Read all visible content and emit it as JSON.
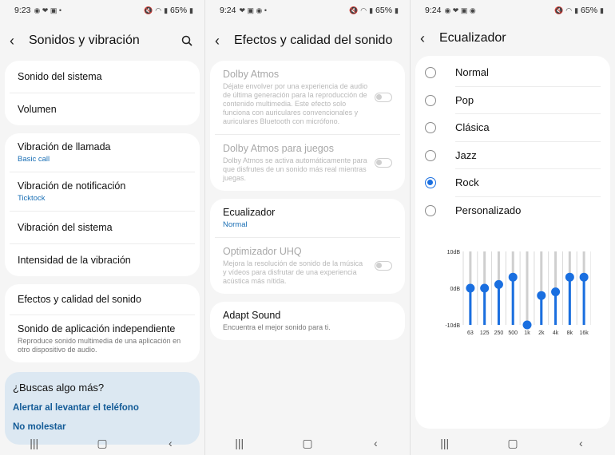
{
  "screen1": {
    "status": {
      "time": "9:23",
      "battery": "65%"
    },
    "title": "Sonidos y vibración",
    "group1": [
      {
        "title": "Sonido del sistema"
      },
      {
        "title": "Volumen"
      }
    ],
    "group2": [
      {
        "title": "Vibración de llamada",
        "sub": "Basic call"
      },
      {
        "title": "Vibración de notificación",
        "sub": "Ticktock"
      },
      {
        "title": "Vibración del sistema"
      },
      {
        "title": "Intensidad de la vibración"
      }
    ],
    "group3": [
      {
        "title": "Efectos y calidad del sonido"
      },
      {
        "title": "Sonido de aplicación independiente",
        "desc": "Reproduce sonido multimedia de una aplicación en otro dispositivo de audio."
      }
    ],
    "help": {
      "title": "¿Buscas algo más?",
      "link1": "Alertar al levantar el teléfono",
      "link2": "No molestar"
    }
  },
  "screen2": {
    "status": {
      "time": "9:24",
      "battery": "65%"
    },
    "title": "Efectos y calidad del sonido",
    "dolby": {
      "title": "Dolby Atmos",
      "desc": "Déjate envolver por una experiencia de audio de última generación para la reproducción de contenido multimedia. Este efecto solo funciona con auriculares convencionales y auriculares Bluetooth con micrófono."
    },
    "dolby_games": {
      "title": "Dolby Atmos para juegos",
      "desc": "Dolby Atmos se activa automáticamente para que disfrutes de un sonido más real mientras juegas."
    },
    "eq": {
      "title": "Ecualizador",
      "sub": "Normal"
    },
    "uhq": {
      "title": "Optimizador UHQ",
      "desc": "Mejora la resolución de sonido de la música y vídeos para disfrutar de una experiencia acústica más nítida."
    },
    "adapt": {
      "title": "Adapt Sound",
      "desc": "Encuentra el mejor sonido para ti."
    }
  },
  "screen3": {
    "status": {
      "time": "9:24",
      "battery": "65%"
    },
    "title": "Ecualizador",
    "options": [
      "Normal",
      "Pop",
      "Clásica",
      "Jazz",
      "Rock",
      "Personalizado"
    ],
    "selected": "Rock",
    "accent": "#1a6fe0"
  },
  "chart_data": {
    "type": "bar",
    "categories": [
      "63",
      "125",
      "250",
      "500",
      "1k",
      "2k",
      "4k",
      "8k",
      "16k"
    ],
    "values": [
      0,
      0,
      1,
      3,
      -10,
      -2,
      -1,
      3,
      3
    ],
    "ylim": [
      -10,
      10
    ],
    "yticks": [
      "10dB",
      "0dB",
      "-10dB"
    ]
  }
}
